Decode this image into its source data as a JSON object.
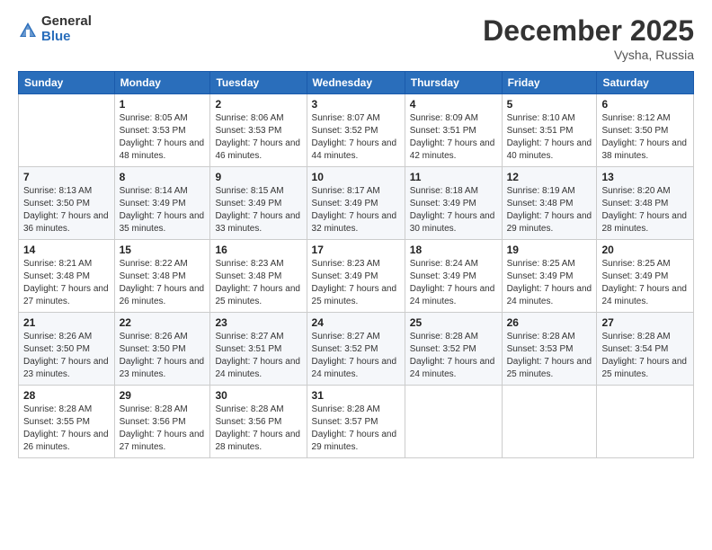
{
  "header": {
    "logo_general": "General",
    "logo_blue": "Blue",
    "month_title": "December 2025",
    "location": "Vysha, Russia"
  },
  "weekdays": [
    "Sunday",
    "Monday",
    "Tuesday",
    "Wednesday",
    "Thursday",
    "Friday",
    "Saturday"
  ],
  "weeks": [
    [
      {
        "day": "",
        "sunrise": "",
        "sunset": "",
        "daylight": ""
      },
      {
        "day": "1",
        "sunrise": "Sunrise: 8:05 AM",
        "sunset": "Sunset: 3:53 PM",
        "daylight": "Daylight: 7 hours and 48 minutes."
      },
      {
        "day": "2",
        "sunrise": "Sunrise: 8:06 AM",
        "sunset": "Sunset: 3:53 PM",
        "daylight": "Daylight: 7 hours and 46 minutes."
      },
      {
        "day": "3",
        "sunrise": "Sunrise: 8:07 AM",
        "sunset": "Sunset: 3:52 PM",
        "daylight": "Daylight: 7 hours and 44 minutes."
      },
      {
        "day": "4",
        "sunrise": "Sunrise: 8:09 AM",
        "sunset": "Sunset: 3:51 PM",
        "daylight": "Daylight: 7 hours and 42 minutes."
      },
      {
        "day": "5",
        "sunrise": "Sunrise: 8:10 AM",
        "sunset": "Sunset: 3:51 PM",
        "daylight": "Daylight: 7 hours and 40 minutes."
      },
      {
        "day": "6",
        "sunrise": "Sunrise: 8:12 AM",
        "sunset": "Sunset: 3:50 PM",
        "daylight": "Daylight: 7 hours and 38 minutes."
      }
    ],
    [
      {
        "day": "7",
        "sunrise": "Sunrise: 8:13 AM",
        "sunset": "Sunset: 3:50 PM",
        "daylight": "Daylight: 7 hours and 36 minutes."
      },
      {
        "day": "8",
        "sunrise": "Sunrise: 8:14 AM",
        "sunset": "Sunset: 3:49 PM",
        "daylight": "Daylight: 7 hours and 35 minutes."
      },
      {
        "day": "9",
        "sunrise": "Sunrise: 8:15 AM",
        "sunset": "Sunset: 3:49 PM",
        "daylight": "Daylight: 7 hours and 33 minutes."
      },
      {
        "day": "10",
        "sunrise": "Sunrise: 8:17 AM",
        "sunset": "Sunset: 3:49 PM",
        "daylight": "Daylight: 7 hours and 32 minutes."
      },
      {
        "day": "11",
        "sunrise": "Sunrise: 8:18 AM",
        "sunset": "Sunset: 3:49 PM",
        "daylight": "Daylight: 7 hours and 30 minutes."
      },
      {
        "day": "12",
        "sunrise": "Sunrise: 8:19 AM",
        "sunset": "Sunset: 3:48 PM",
        "daylight": "Daylight: 7 hours and 29 minutes."
      },
      {
        "day": "13",
        "sunrise": "Sunrise: 8:20 AM",
        "sunset": "Sunset: 3:48 PM",
        "daylight": "Daylight: 7 hours and 28 minutes."
      }
    ],
    [
      {
        "day": "14",
        "sunrise": "Sunrise: 8:21 AM",
        "sunset": "Sunset: 3:48 PM",
        "daylight": "Daylight: 7 hours and 27 minutes."
      },
      {
        "day": "15",
        "sunrise": "Sunrise: 8:22 AM",
        "sunset": "Sunset: 3:48 PM",
        "daylight": "Daylight: 7 hours and 26 minutes."
      },
      {
        "day": "16",
        "sunrise": "Sunrise: 8:23 AM",
        "sunset": "Sunset: 3:48 PM",
        "daylight": "Daylight: 7 hours and 25 minutes."
      },
      {
        "day": "17",
        "sunrise": "Sunrise: 8:23 AM",
        "sunset": "Sunset: 3:49 PM",
        "daylight": "Daylight: 7 hours and 25 minutes."
      },
      {
        "day": "18",
        "sunrise": "Sunrise: 8:24 AM",
        "sunset": "Sunset: 3:49 PM",
        "daylight": "Daylight: 7 hours and 24 minutes."
      },
      {
        "day": "19",
        "sunrise": "Sunrise: 8:25 AM",
        "sunset": "Sunset: 3:49 PM",
        "daylight": "Daylight: 7 hours and 24 minutes."
      },
      {
        "day": "20",
        "sunrise": "Sunrise: 8:25 AM",
        "sunset": "Sunset: 3:49 PM",
        "daylight": "Daylight: 7 hours and 24 minutes."
      }
    ],
    [
      {
        "day": "21",
        "sunrise": "Sunrise: 8:26 AM",
        "sunset": "Sunset: 3:50 PM",
        "daylight": "Daylight: 7 hours and 23 minutes."
      },
      {
        "day": "22",
        "sunrise": "Sunrise: 8:26 AM",
        "sunset": "Sunset: 3:50 PM",
        "daylight": "Daylight: 7 hours and 23 minutes."
      },
      {
        "day": "23",
        "sunrise": "Sunrise: 8:27 AM",
        "sunset": "Sunset: 3:51 PM",
        "daylight": "Daylight: 7 hours and 24 minutes."
      },
      {
        "day": "24",
        "sunrise": "Sunrise: 8:27 AM",
        "sunset": "Sunset: 3:52 PM",
        "daylight": "Daylight: 7 hours and 24 minutes."
      },
      {
        "day": "25",
        "sunrise": "Sunrise: 8:28 AM",
        "sunset": "Sunset: 3:52 PM",
        "daylight": "Daylight: 7 hours and 24 minutes."
      },
      {
        "day": "26",
        "sunrise": "Sunrise: 8:28 AM",
        "sunset": "Sunset: 3:53 PM",
        "daylight": "Daylight: 7 hours and 25 minutes."
      },
      {
        "day": "27",
        "sunrise": "Sunrise: 8:28 AM",
        "sunset": "Sunset: 3:54 PM",
        "daylight": "Daylight: 7 hours and 25 minutes."
      }
    ],
    [
      {
        "day": "28",
        "sunrise": "Sunrise: 8:28 AM",
        "sunset": "Sunset: 3:55 PM",
        "daylight": "Daylight: 7 hours and 26 minutes."
      },
      {
        "day": "29",
        "sunrise": "Sunrise: 8:28 AM",
        "sunset": "Sunset: 3:56 PM",
        "daylight": "Daylight: 7 hours and 27 minutes."
      },
      {
        "day": "30",
        "sunrise": "Sunrise: 8:28 AM",
        "sunset": "Sunset: 3:56 PM",
        "daylight": "Daylight: 7 hours and 28 minutes."
      },
      {
        "day": "31",
        "sunrise": "Sunrise: 8:28 AM",
        "sunset": "Sunset: 3:57 PM",
        "daylight": "Daylight: 7 hours and 29 minutes."
      },
      {
        "day": "",
        "sunrise": "",
        "sunset": "",
        "daylight": ""
      },
      {
        "day": "",
        "sunrise": "",
        "sunset": "",
        "daylight": ""
      },
      {
        "day": "",
        "sunrise": "",
        "sunset": "",
        "daylight": ""
      }
    ]
  ]
}
